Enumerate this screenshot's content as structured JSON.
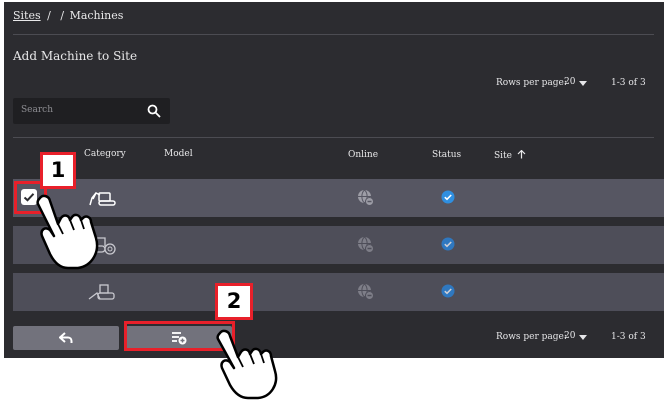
{
  "breadcrumb": {
    "sites": "Sites",
    "sep1": "/",
    "sep2": "/",
    "machines": "Machines"
  },
  "page_title": "Add Machine to Site",
  "pagination_top": {
    "rows_label": "Rows per page:",
    "rows_value": "20",
    "range": "1-3 of 3"
  },
  "pagination_bottom": {
    "rows_label": "Rows per page:",
    "rows_value": "20",
    "range": "1-3 of 3"
  },
  "search": {
    "placeholder": "Search"
  },
  "table": {
    "columns": {
      "category": "Category",
      "model": "Model",
      "online": "Online",
      "status": "Status",
      "site": "Site"
    },
    "sort": {
      "column": "site",
      "direction": "ascending"
    },
    "rows": [
      {
        "category_icon": "excavator-icon",
        "selected": true,
        "online": "offline-globe-icon",
        "status": "check-circle-icon"
      },
      {
        "category_icon": "roller-icon",
        "selected": false,
        "online": "offline-globe-icon",
        "status": "check-circle-icon"
      },
      {
        "category_icon": "paver-icon",
        "selected": false,
        "online": "offline-globe-icon",
        "status": "check-circle-icon"
      }
    ]
  },
  "buttons": {
    "back_icon": "back-arrow-icon",
    "add_icon": "playlist-add-icon"
  },
  "callouts": {
    "first": "1",
    "second": "2"
  },
  "colors": {
    "panel": "#2c2c30",
    "row": "#4e4e59",
    "status_blue": "#2f8fe0",
    "callout_red": "#e8202a"
  }
}
